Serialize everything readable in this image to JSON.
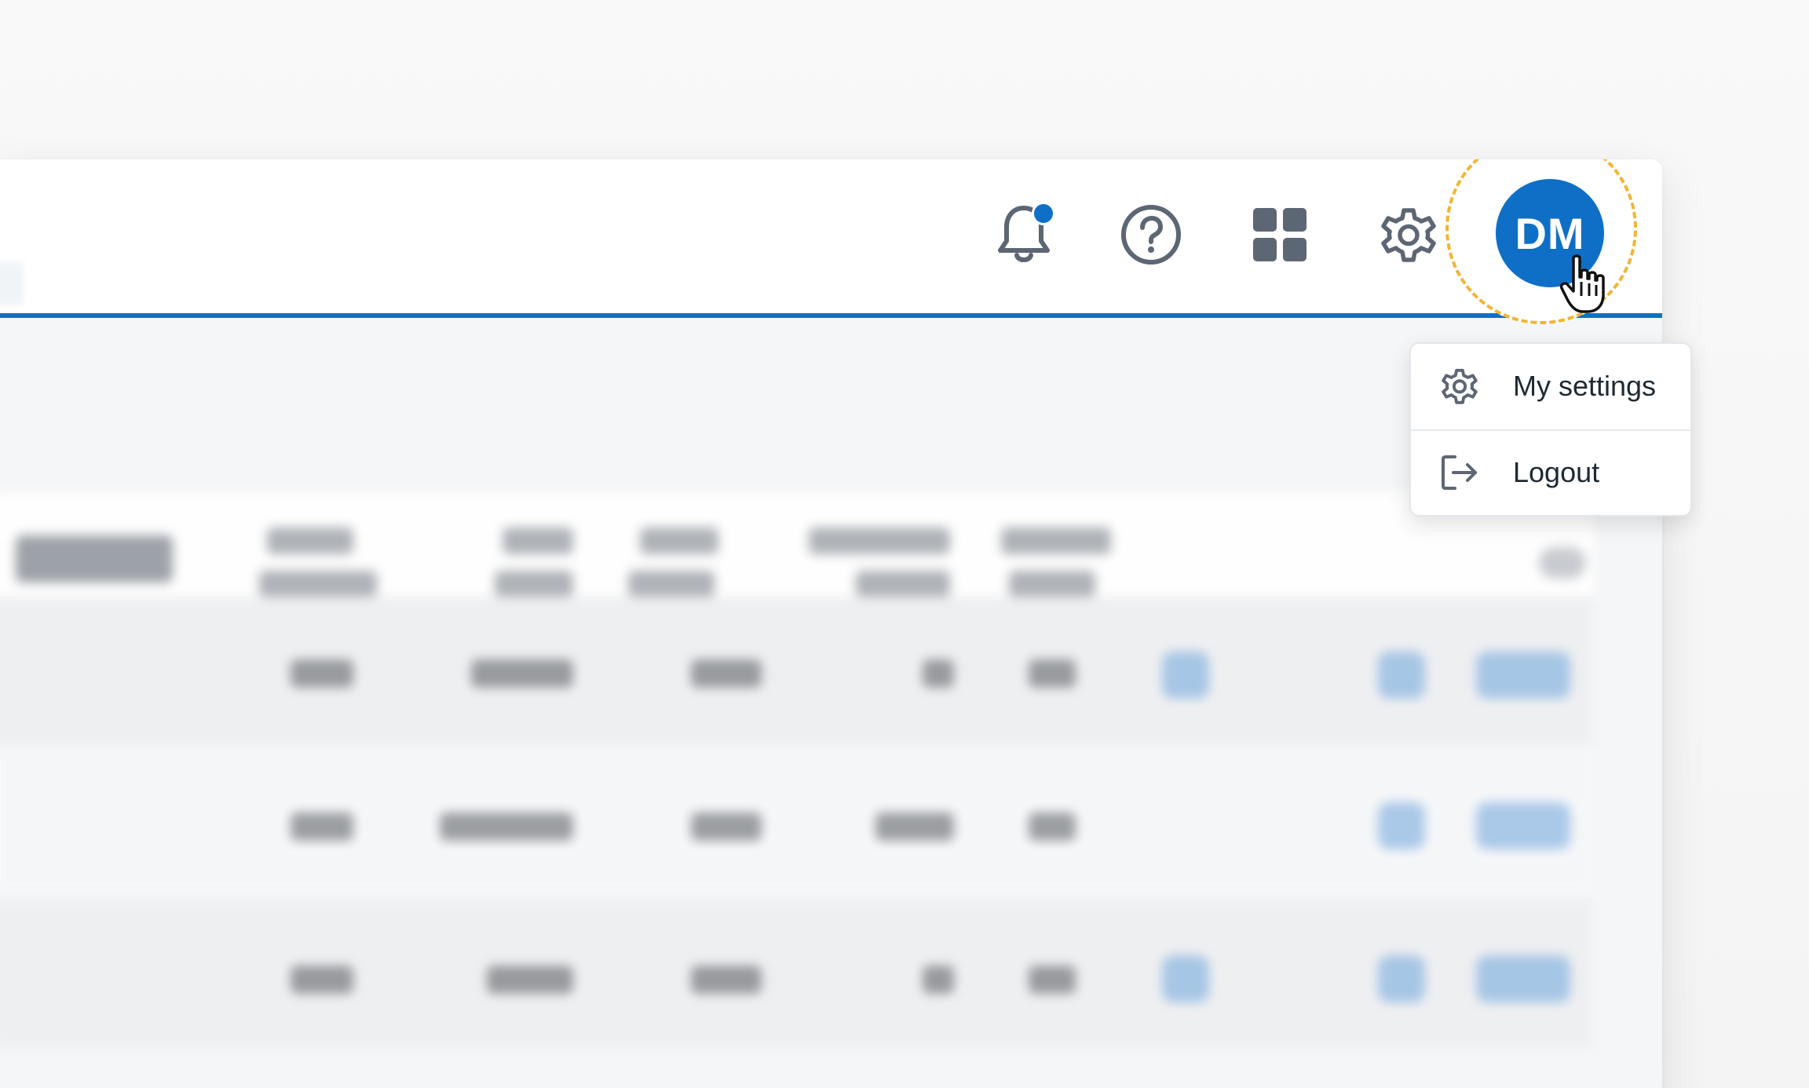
{
  "header": {
    "avatar_initials": "DM",
    "icons": [
      "bell-icon",
      "help-circle-icon",
      "apps-grid-icon",
      "gear-icon"
    ],
    "has_notification": true
  },
  "user_menu": {
    "items": [
      {
        "label": "My settings",
        "icon": "gear-icon"
      },
      {
        "label": "Logout",
        "icon": "logout-icon"
      }
    ]
  },
  "colors": {
    "accent": "#0f6fc6",
    "highlight_ring": "#f2b533",
    "icon_gray": "#5d6673"
  }
}
